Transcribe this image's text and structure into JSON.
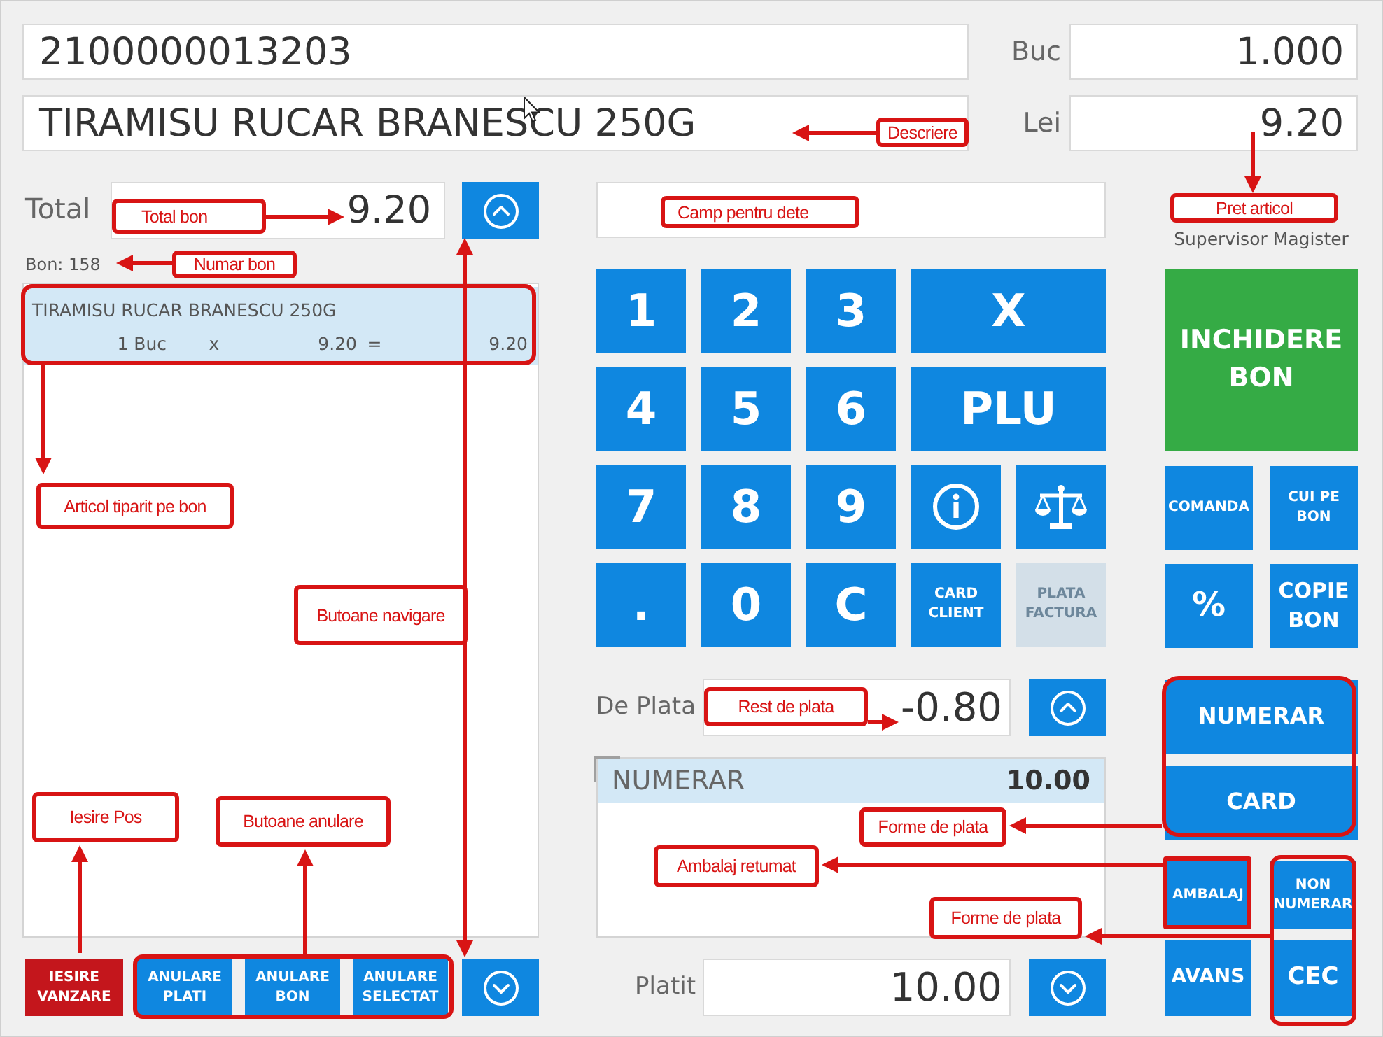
{
  "item_entry": {
    "barcode": "2100000013203",
    "description": "TIRAMISU RUCAR BRANESCU 250G",
    "quantity_label": "Buc",
    "quantity": "1.000",
    "price_label": "Lei",
    "price": "9.20"
  },
  "receipt": {
    "total_label": "Total",
    "total": "9.20",
    "number": "Bon: 158",
    "items": [
      {
        "name": "TIRAMISU RUCAR BRANESCU 250G",
        "quantity": "1 Buc",
        "times": "x",
        "unit_price": "9.20",
        "equals": "=",
        "amount": "9.20",
        "selected": true
      }
    ]
  },
  "exit_button": "IESIRE VANZARE",
  "cancel_buttons": [
    "ANULARE PLATI",
    "ANULARE BON",
    "ANULARE SELECTAT"
  ],
  "keypad": [
    {
      "label": "1",
      "kind": "digit",
      "disabled": false
    },
    {
      "label": "2",
      "kind": "digit",
      "disabled": false
    },
    {
      "label": "3",
      "kind": "digit",
      "disabled": false
    },
    {
      "label": "X",
      "kind": "wide",
      "disabled": false
    },
    {
      "label": "4",
      "kind": "digit",
      "disabled": false
    },
    {
      "label": "5",
      "kind": "digit",
      "disabled": false
    },
    {
      "label": "6",
      "kind": "digit",
      "disabled": false
    },
    {
      "label": "PLU",
      "kind": "wide",
      "disabled": false
    },
    {
      "label": "7",
      "kind": "digit",
      "disabled": false
    },
    {
      "label": "8",
      "kind": "digit",
      "disabled": false
    },
    {
      "label": "9",
      "kind": "digit",
      "disabled": false
    },
    {
      "kind": "info",
      "disabled": false
    },
    {
      "kind": "scale",
      "disabled": false
    },
    {
      "label": ".",
      "kind": "digit",
      "disabled": false
    },
    {
      "label": "0",
      "kind": "digit",
      "disabled": false
    },
    {
      "label": "C",
      "kind": "digit",
      "disabled": false
    },
    {
      "label": "CARD CLIENT",
      "kind": "text",
      "disabled": false
    },
    {
      "label": "PLATA FACTURA",
      "kind": "text",
      "disabled": true
    }
  ],
  "payment": {
    "due_label": "De Plata",
    "due": "-0.80",
    "items": [
      {
        "method": "NUMERAR",
        "amount": "10.00",
        "selected": true
      }
    ],
    "paid_label": "Platit",
    "paid": "10.00"
  },
  "operator": "Supervisor Magister",
  "close_button": "INCHIDERE BON",
  "function_buttons": [
    [
      "COMANDA",
      "CUI PE BON"
    ],
    [
      "%",
      "COPIE BON"
    ]
  ],
  "payment_buttons": [
    "NUMERAR",
    "CARD"
  ],
  "extra_buttons": [
    [
      "AMBALAJ",
      "NON NUMERAR"
    ],
    [
      "AVANS",
      "CEC"
    ]
  ],
  "annotations": [
    "Descriere",
    "Pret articol",
    "Total bon",
    "Camp pentru dete",
    "Numar bon",
    "Articol tiparit pe bon",
    "Butoane navigare",
    "Iesire Pos",
    "Butoane anulare",
    "Rest de plata",
    "Forme de plata",
    "Ambalaj retumat",
    "Forme de plata"
  ]
}
